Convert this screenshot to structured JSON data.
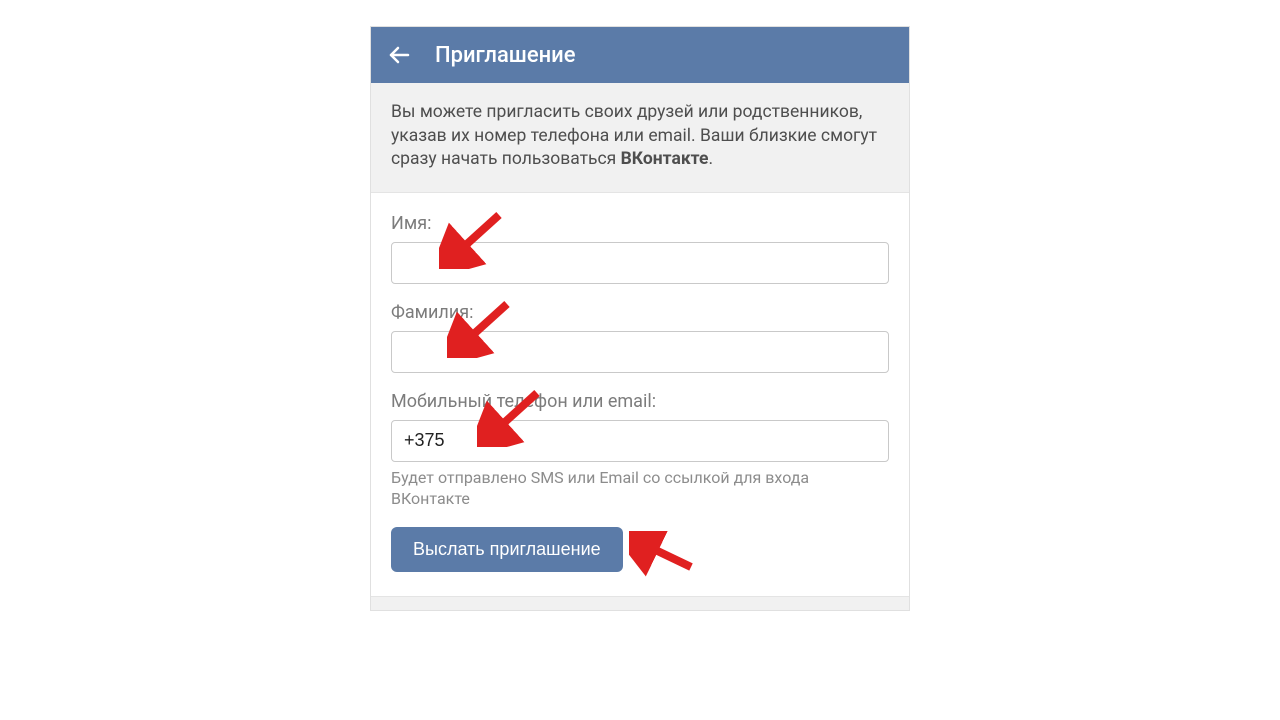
{
  "header": {
    "title": "Приглашение"
  },
  "info": {
    "text_prefix": "Вы можете пригласить своих друзей или родственников, указав их номер телефона или email. Ваши близкие смогут сразу начать пользоваться ",
    "text_bold": "ВКонтакте",
    "text_suffix": "."
  },
  "form": {
    "first_name": {
      "label": "Имя:",
      "value": ""
    },
    "last_name": {
      "label": "Фамилия:",
      "value": ""
    },
    "contact": {
      "label": "Мобильный телефон или email:",
      "value": "+375",
      "hint": "Будет отправлено SMS или Email со ссылкой для входа ВКонтакте"
    },
    "submit_label": "Выслать приглашение"
  },
  "colors": {
    "accent": "#5b7ba8",
    "arrow": "#e02020"
  }
}
